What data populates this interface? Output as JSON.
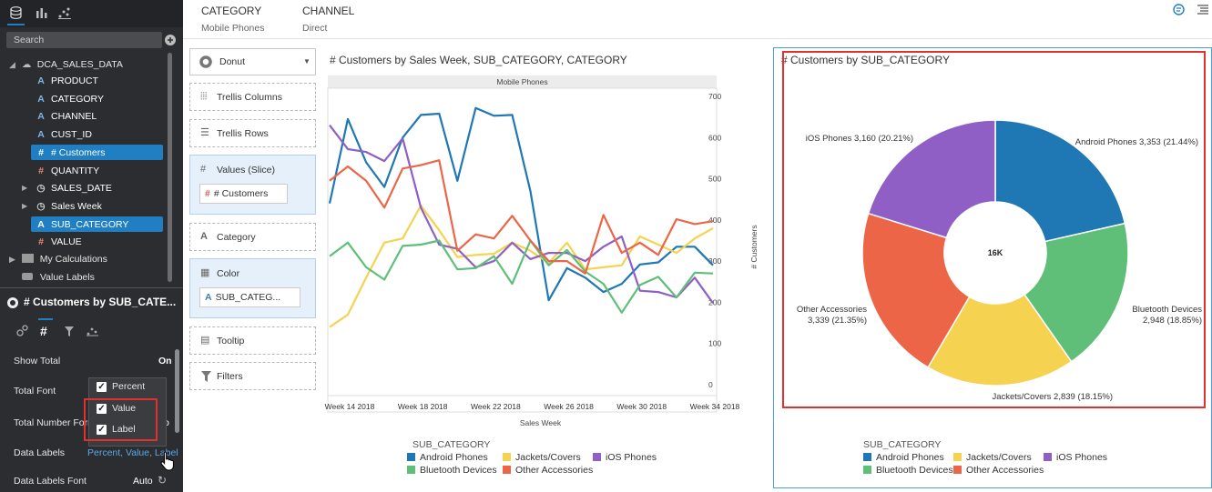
{
  "search": {
    "placeholder": "Search"
  },
  "data_panel": {
    "dataset": "DCA_SALES_DATA",
    "columns": [
      {
        "label": "PRODUCT",
        "type": "attribute"
      },
      {
        "label": "CATEGORY",
        "type": "attribute"
      },
      {
        "label": "CHANNEL",
        "type": "attribute"
      },
      {
        "label": "CUST_ID",
        "type": "attribute"
      },
      {
        "label": "# Customers",
        "type": "measure",
        "selected": true
      },
      {
        "label": "QUANTITY",
        "type": "measure"
      },
      {
        "label": "SALES_DATE",
        "type": "time"
      },
      {
        "label": "Sales Week",
        "type": "time"
      },
      {
        "label": "SUB_CATEGORY",
        "type": "attribute",
        "selected": true
      },
      {
        "label": "VALUE",
        "type": "measure"
      }
    ],
    "my_calculations": "My Calculations",
    "value_labels": "Value Labels"
  },
  "properties": {
    "title": "# Customers by SUB_CATE...",
    "rows": [
      {
        "label": "Show Total",
        "value": "On"
      },
      {
        "label": "Total Font",
        "value": ""
      },
      {
        "label": "Total Number Form",
        "value": "o"
      },
      {
        "label": "Data Labels",
        "value": "Percent, Value, Label"
      },
      {
        "label": "Data Labels Font",
        "value": "Auto"
      }
    ],
    "popup": [
      {
        "label": "Percent",
        "checked": true
      },
      {
        "label": "Value",
        "checked": true
      },
      {
        "label": "Label",
        "checked": true
      }
    ]
  },
  "filters_bar": [
    {
      "name": "CATEGORY",
      "value": "Mobile Phones"
    },
    {
      "name": "CHANNEL",
      "value": "Direct"
    }
  ],
  "grammar": {
    "chart_type": "Donut",
    "trellis_columns": "Trellis Columns",
    "trellis_rows": "Trellis Rows",
    "values_slice": "Values (Slice)",
    "values_item": "# Customers",
    "category": "Category",
    "color": "Color",
    "color_item": "SUB_CATEG...",
    "tooltip": "Tooltip",
    "filters": "Filters"
  },
  "colors": {
    "Android Phones": "#1f77b4",
    "Jackets/Covers": "#f5d24f",
    "iOS Phones": "#8f5fc6",
    "Bluetooth Devices": "#5fbf78",
    "Other Accessories": "#ec6547",
    "accent": "#1f7fc2"
  },
  "chart_data": [
    {
      "type": "line",
      "title": "# Customers by Sales Week, SUB_CATEGORY, CATEGORY",
      "panel": "Mobile Phones",
      "xlabel": "Sales Week",
      "ylabel": "# Customers",
      "ylim": [
        0,
        700
      ],
      "yticks": [
        0,
        100,
        200,
        300,
        400,
        500,
        600,
        700
      ],
      "xticks": [
        "Week 14 2018",
        "Week 18 2018",
        "Week 22 2018",
        "Week 26 2018",
        "Week 30 2018",
        "Week 34 2018"
      ],
      "legend_title": "SUB_CATEGORY",
      "series": [
        {
          "name": "Android Phones",
          "values": [
            440,
            645,
            540,
            480,
            600,
            655,
            658,
            495,
            672,
            653,
            655,
            470,
            205,
            283,
            260,
            225,
            245,
            292,
            297,
            335,
            335,
            290
          ]
        },
        {
          "name": "Jackets/Covers",
          "values": [
            140,
            170,
            260,
            345,
            355,
            435,
            375,
            310,
            315,
            318,
            345,
            325,
            295,
            345,
            280,
            285,
            290,
            360,
            340,
            320,
            355,
            380
          ]
        },
        {
          "name": "iOS Phones",
          "values": [
            630,
            572,
            565,
            543,
            598,
            430,
            340,
            330,
            285,
            300,
            345,
            305,
            320,
            320,
            300,
            335,
            360,
            228,
            225,
            212,
            260,
            198
          ]
        },
        {
          "name": "Bluetooth Devices",
          "values": [
            312,
            345,
            285,
            255,
            337,
            340,
            350,
            280,
            283,
            312,
            245,
            350,
            290,
            327,
            275,
            245,
            175,
            242,
            262,
            212,
            272,
            270
          ]
        },
        {
          "name": "Other Accessories",
          "values": [
            495,
            530,
            495,
            430,
            525,
            533,
            545,
            325,
            365,
            355,
            410,
            350,
            300,
            300,
            270,
            412,
            320,
            345,
            315,
            402,
            390,
            397
          ]
        }
      ]
    },
    {
      "type": "pie",
      "title": "# Customers by SUB_CATEGORY",
      "total_label": "16K",
      "legend_title": "SUB_CATEGORY",
      "slices": [
        {
          "name": "Android Phones",
          "value": 3353,
          "label": "Android Phones 3,353 (21.44%)"
        },
        {
          "name": "Bluetooth Devices",
          "value": 2948,
          "label": "Bluetooth Devices 2,948 (18.85%)"
        },
        {
          "name": "Jackets/Covers",
          "value": 2839,
          "label": "Jackets/Covers 2,839 (18.15%)"
        },
        {
          "name": "Other Accessories",
          "value": 3339,
          "label": "Other Accessories 3,339 (21.35%)"
        },
        {
          "name": "iOS Phones",
          "value": 3160,
          "label": "iOS Phones 3,160 (20.21%)"
        }
      ]
    }
  ]
}
